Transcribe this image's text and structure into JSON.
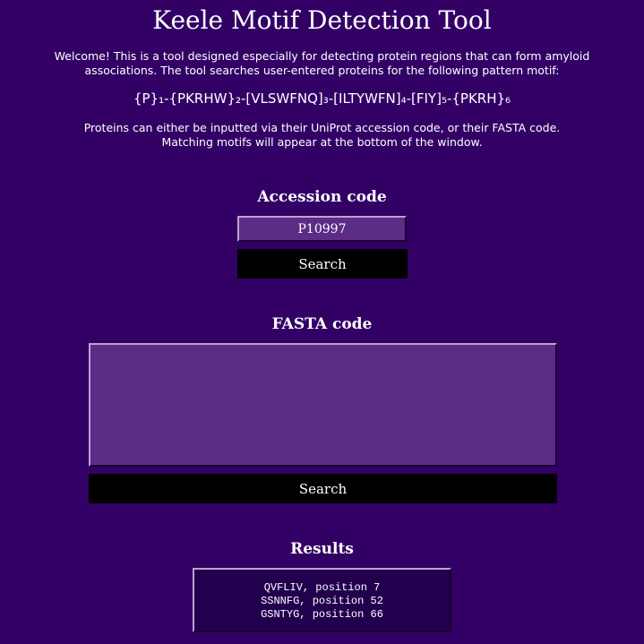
{
  "app": {
    "title": "Keele Motif Detection Tool"
  },
  "intro": {
    "welcome": "Welcome! This is a tool designed especially for detecting protein regions that can form amyloid associations. The tool searches user-entered proteins for the following pattern motif:",
    "motif": "{P}₁-{PKRHW}₂-[VLSWFNQ]₃-[ILTYWFN]₄-[FIY]₅-{PKRH}₆",
    "instructions_line1": "Proteins can either be inputted via their UniProt accession code, or their FASTA code.",
    "instructions_line2": "Matching motifs will appear at the bottom of the window."
  },
  "accession": {
    "heading": "Accession code",
    "value": "P10997",
    "search_label": "Search"
  },
  "fasta": {
    "heading": "FASTA code",
    "value": "",
    "search_label": "Search"
  },
  "results": {
    "heading": "Results",
    "lines": [
      "QVFLIV, position 7",
      "SSNNFG, position 52",
      "GSNTYG, position 66"
    ]
  },
  "colors": {
    "background": "#330066",
    "input_fill": "#5b2d87",
    "button_fill": "#000000",
    "results_fill": "#22004d",
    "text": "#ffffff"
  }
}
